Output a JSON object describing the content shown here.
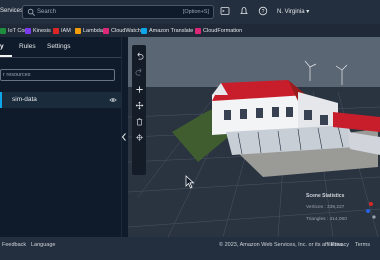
{
  "topbar": {
    "services_label": "Services",
    "search_placeholder": "Search",
    "search_shortcut": "[Option+S]",
    "region": "N. Virginia ▾"
  },
  "favorites": [
    {
      "label": "IoT Core",
      "color": "#1e8e3e"
    },
    {
      "label": "Kinesis",
      "color": "#7c3aed"
    },
    {
      "label": "IAM",
      "color": "#dc2626"
    },
    {
      "label": "Lambda",
      "color": "#f59e0b"
    },
    {
      "label": "CloudWatch",
      "color": "#db2777"
    },
    {
      "label": "Amazon Translate",
      "color": "#0ea5e9"
    },
    {
      "label": "CloudFormation",
      "color": "#db2777"
    }
  ],
  "left_panel": {
    "tabs": [
      "y",
      "Rules",
      "Settings"
    ],
    "filter_placeholder": "r resources",
    "selected_item": "sim-data"
  },
  "viewport": {
    "stats_title": "Scene Statistics",
    "vertices": "Vertices : 339,227",
    "triangles": "Triangles : 414,060"
  },
  "footer": {
    "feedback": "Feedback",
    "language": "Language",
    "copyright": "© 2023, Amazon Web Services, Inc. or its affiliates.",
    "privacy": "Privacy",
    "terms": "Terms"
  },
  "colors": {
    "topbar": "#232f3e",
    "panel": "#0f1b2a",
    "viewport": "#2a3340",
    "roof": "#c81e2b"
  }
}
